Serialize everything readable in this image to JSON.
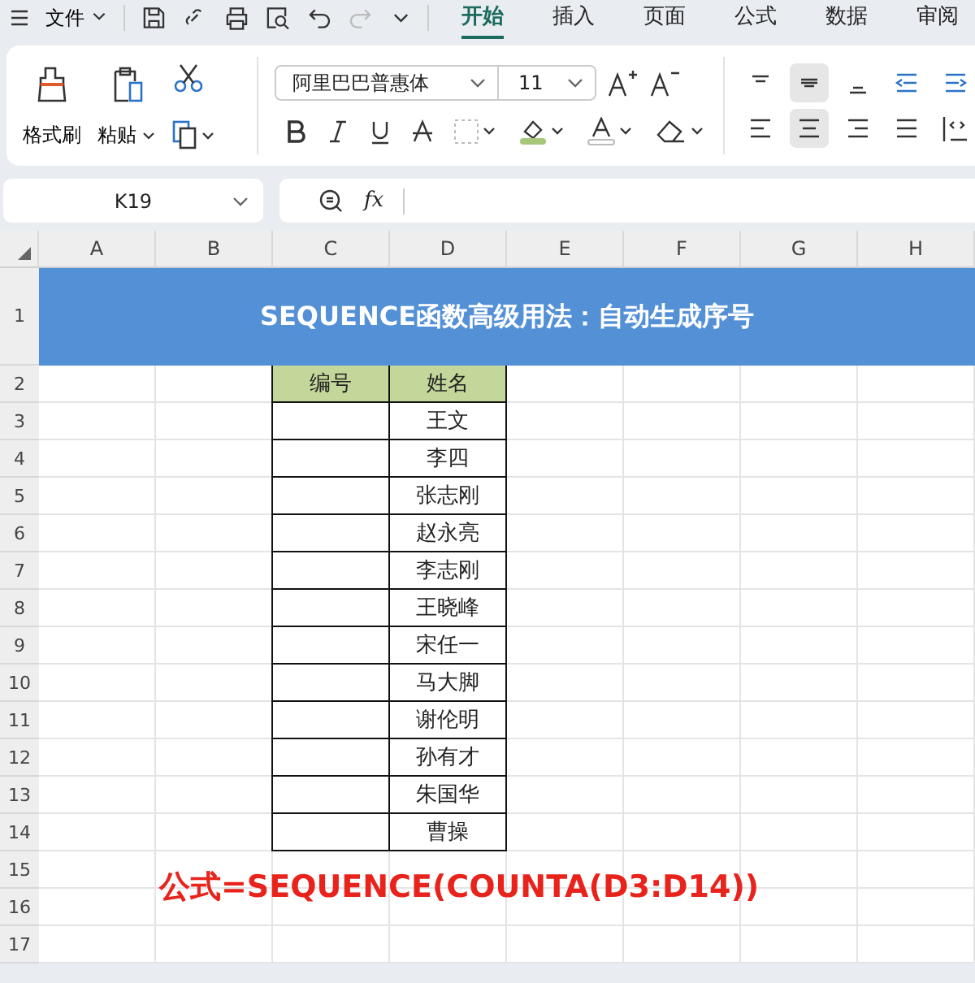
{
  "menu": {
    "label": "文件"
  },
  "tabs": [
    {
      "label": "开始",
      "selected": true
    },
    {
      "label": "插入",
      "selected": false
    },
    {
      "label": "页面",
      "selected": false
    },
    {
      "label": "公式",
      "selected": false
    },
    {
      "label": "数据",
      "selected": false
    },
    {
      "label": "审阅",
      "selected": false
    }
  ],
  "ribbon": {
    "format_painter": "格式刷",
    "paste": "粘贴",
    "font_name": "阿里巴巴普惠体",
    "font_size": "11"
  },
  "name_box": "K19",
  "formula_label": "fx",
  "columns": [
    "A",
    "B",
    "C",
    "D",
    "E",
    "F",
    "G",
    "H"
  ],
  "row_numbers": [
    "1",
    "2",
    "3",
    "4",
    "5",
    "6",
    "7",
    "8",
    "9",
    "10",
    "11",
    "12",
    "13",
    "14",
    "15",
    "16",
    "17"
  ],
  "title": "SEQUENCE函数高级用法：自动生成序号",
  "table": {
    "headers": [
      "编号",
      "姓名"
    ],
    "rows": [
      [
        "",
        "王文"
      ],
      [
        "",
        "李四"
      ],
      [
        "",
        "张志刚"
      ],
      [
        "",
        "赵永亮"
      ],
      [
        "",
        "李志刚"
      ],
      [
        "",
        "王晓峰"
      ],
      [
        "",
        "宋任一"
      ],
      [
        "",
        "马大脚"
      ],
      [
        "",
        "谢伦明"
      ],
      [
        "",
        "孙有才"
      ],
      [
        "",
        "朱国华"
      ],
      [
        "",
        "曹操"
      ]
    ]
  },
  "note": "公式=SEQUENCE(COUNTA(D3:D14))"
}
